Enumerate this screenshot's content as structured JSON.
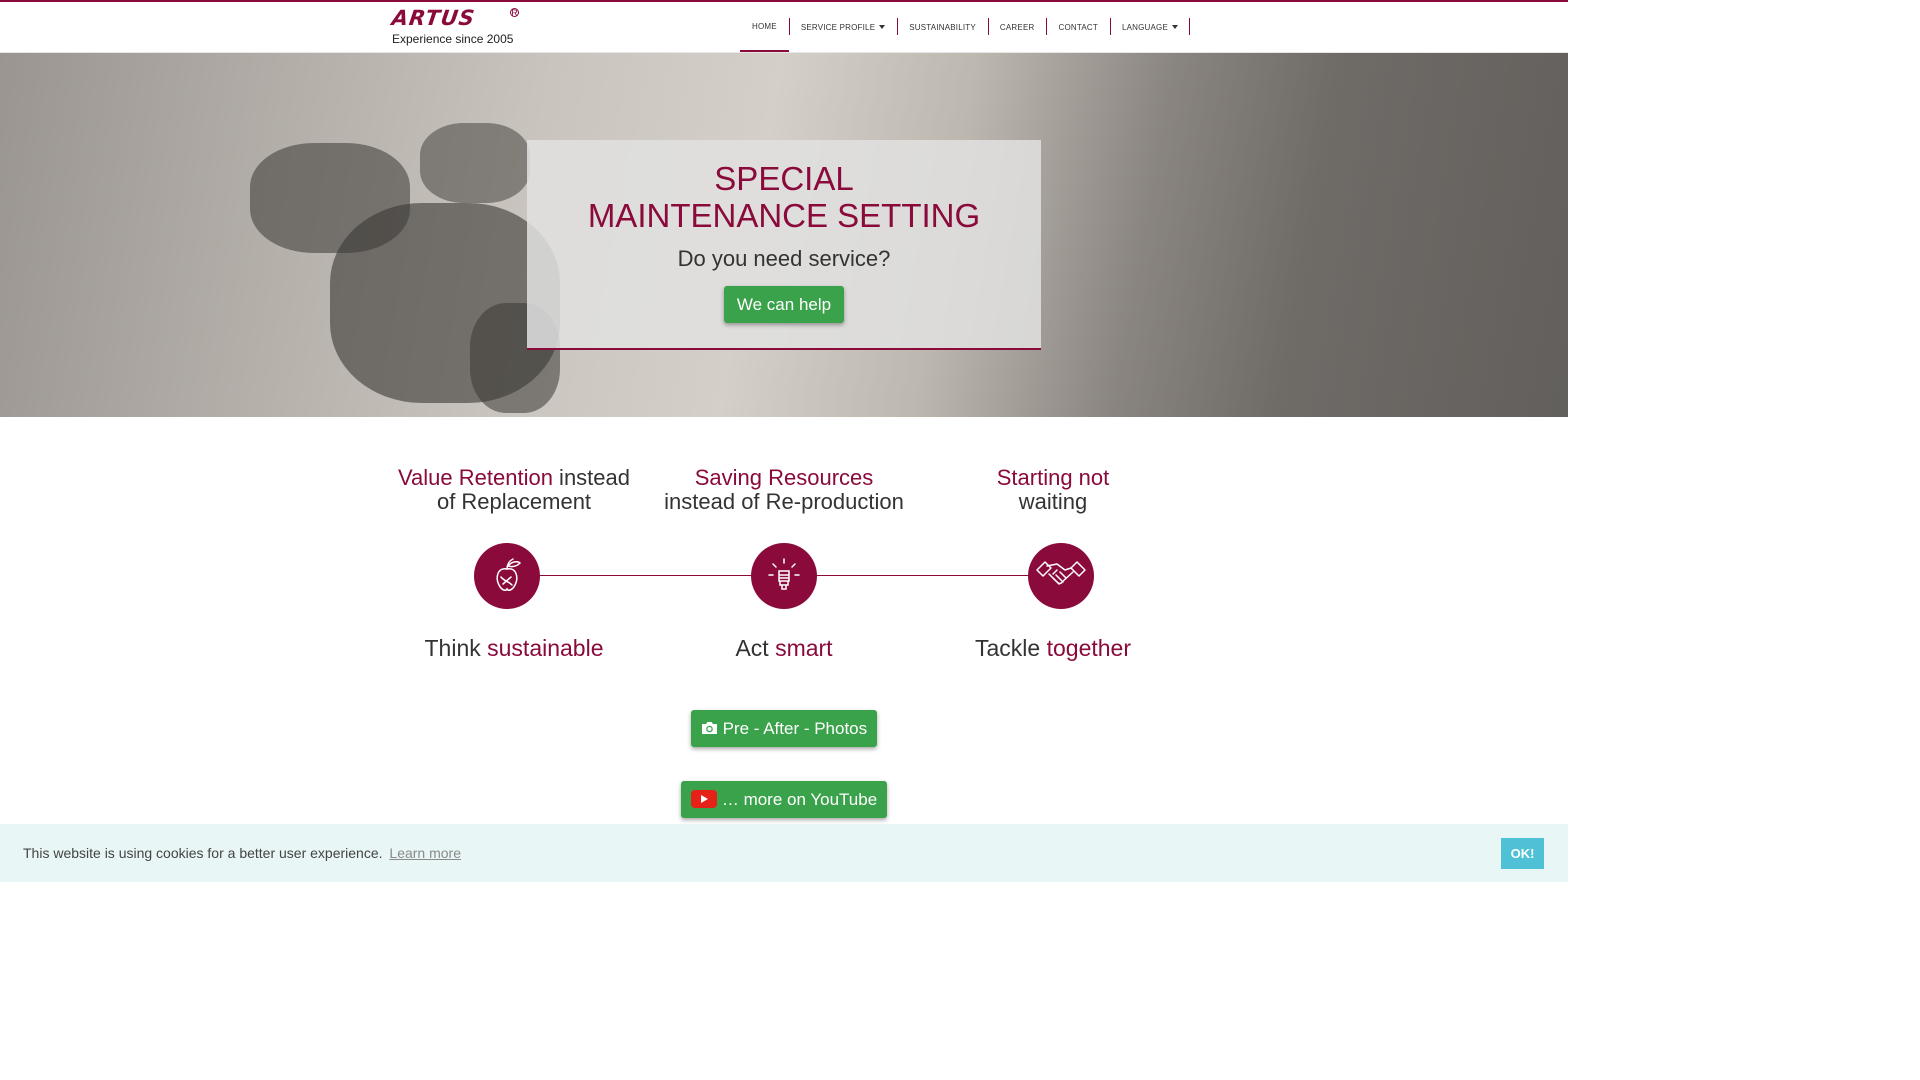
{
  "header": {
    "logo_text": "ARTUS",
    "logo_reg": "R",
    "tagline": "Experience since 2005",
    "nav": [
      {
        "label": "HOME"
      },
      {
        "label": "SERVICE PROFILE"
      },
      {
        "label": "SUSTAINABILITY"
      },
      {
        "label": "CAREER"
      },
      {
        "label": "CONTACT"
      },
      {
        "label": "LANGUAGE"
      }
    ]
  },
  "hero": {
    "title_line1": "SPECIAL",
    "title_line2": "MAINTENANCE SETTING",
    "subtitle": "Do you need service?",
    "cta": "We can help"
  },
  "values": [
    {
      "highlight": "Value Retention",
      "rest1": " instead",
      "rest2": "of Replacement",
      "think_pre": "Think ",
      "think_hl": "sustainable",
      "icon": "apple-leaf-icon"
    },
    {
      "highlight": "Saving Resources",
      "rest1": "",
      "rest2": "instead of Re-production",
      "think_pre": "Act ",
      "think_hl": "smart",
      "icon": "lightbulb-icon"
    },
    {
      "highlight": "Starting not",
      "rest1": "",
      "rest2": "waiting",
      "think_pre": "Tackle ",
      "think_hl": "together",
      "icon": "handshake-icon"
    }
  ],
  "buttons": {
    "photos": " Pre - After - Photos",
    "youtube": "… more on YouTube"
  },
  "cookie": {
    "text": "This website is using cookies for a better user experience.",
    "link": "Learn more",
    "ok": "OK!"
  },
  "colors": {
    "brand": "#8a0a3b",
    "button_green": "#3aa24a",
    "cookie_bg": "#e9f6f6",
    "cookie_ok": "#4fc1d6"
  }
}
